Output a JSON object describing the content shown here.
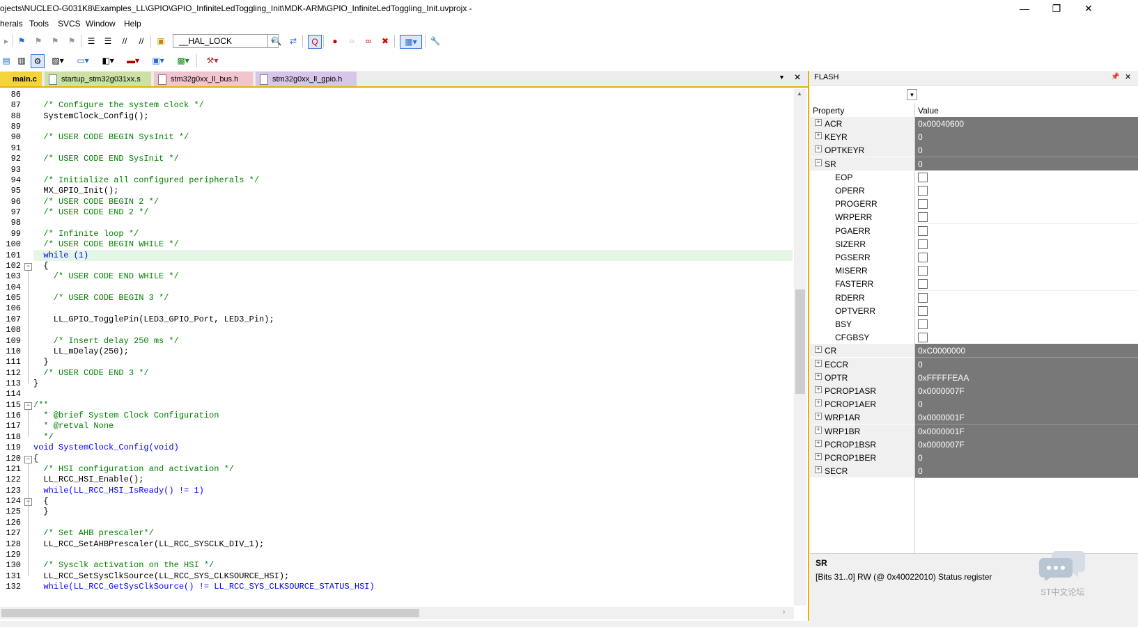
{
  "window": {
    "title": "ojects\\NUCLEO-G031K8\\Examples_LL\\GPIO\\GPIO_InfiniteLedToggling_Init\\MDK-ARM\\GPIO_InfiniteLedToggling_Init.uvprojx -",
    "minimize": "—",
    "maximize": "❐",
    "close": "✕"
  },
  "menu": [
    "herals",
    "Tools",
    "SVCS",
    "Window",
    "Help"
  ],
  "toolbar": {
    "combo_value": "__HAL_LOCK"
  },
  "tabs": [
    {
      "label": "main.c",
      "color": "#f5d33a"
    },
    {
      "label": "startup_stm32g031xx.s",
      "color": "#cde0a6"
    },
    {
      "label": "stm32g0xx_ll_bus.h",
      "color": "#f2c4cf"
    },
    {
      "label": "stm32g0xx_ll_gpio.h",
      "color": "#d7c5ea"
    }
  ],
  "code": [
    {
      "n": "86",
      "t": ""
    },
    {
      "n": "87",
      "t": "  /* Configure the system clock */"
    },
    {
      "n": "88",
      "t": "  SystemClock_Config();"
    },
    {
      "n": "89",
      "t": ""
    },
    {
      "n": "90",
      "t": "  /* USER CODE BEGIN SysInit */"
    },
    {
      "n": "91",
      "t": ""
    },
    {
      "n": "92",
      "t": "  /* USER CODE END SysInit */"
    },
    {
      "n": "93",
      "t": ""
    },
    {
      "n": "94",
      "t": "  /* Initialize all configured peripherals */"
    },
    {
      "n": "95",
      "t": "  MX_GPIO_Init();"
    },
    {
      "n": "96",
      "t": "  /* USER CODE BEGIN 2 */"
    },
    {
      "n": "97",
      "t": "  /* USER CODE END 2 */"
    },
    {
      "n": "98",
      "t": ""
    },
    {
      "n": "99",
      "t": "  /* Infinite loop */"
    },
    {
      "n": "100",
      "t": "  /* USER CODE BEGIN WHILE */"
    },
    {
      "n": "101",
      "t": "  while (1)"
    },
    {
      "n": "102",
      "t": "  {"
    },
    {
      "n": "103",
      "t": "    /* USER CODE END WHILE */"
    },
    {
      "n": "104",
      "t": ""
    },
    {
      "n": "105",
      "t": "    /* USER CODE BEGIN 3 */"
    },
    {
      "n": "106",
      "t": ""
    },
    {
      "n": "107",
      "t": "    LL_GPIO_TogglePin(LED3_GPIO_Port, LED3_Pin);"
    },
    {
      "n": "108",
      "t": ""
    },
    {
      "n": "109",
      "t": "    /* Insert delay 250 ms */"
    },
    {
      "n": "110",
      "t": "    LL_mDelay(250);"
    },
    {
      "n": "111",
      "t": "  }"
    },
    {
      "n": "112",
      "t": "  /* USER CODE END 3 */"
    },
    {
      "n": "113",
      "t": "}"
    },
    {
      "n": "114",
      "t": ""
    },
    {
      "n": "115",
      "t": "/**"
    },
    {
      "n": "116",
      "t": "  * @brief System Clock Configuration"
    },
    {
      "n": "117",
      "t": "  * @retval None"
    },
    {
      "n": "118",
      "t": "  */"
    },
    {
      "n": "119",
      "t": "void SystemClock_Config(void)"
    },
    {
      "n": "120",
      "t": "{"
    },
    {
      "n": "121",
      "t": "  /* HSI configuration and activation */"
    },
    {
      "n": "122",
      "t": "  LL_RCC_HSI_Enable();"
    },
    {
      "n": "123",
      "t": "  while(LL_RCC_HSI_IsReady() != 1)"
    },
    {
      "n": "124",
      "t": "  {"
    },
    {
      "n": "125",
      "t": "  }"
    },
    {
      "n": "126",
      "t": ""
    },
    {
      "n": "127",
      "t": "  /* Set AHB prescaler*/"
    },
    {
      "n": "128",
      "t": "  LL_RCC_SetAHBPrescaler(LL_RCC_SYSCLK_DIV_1);"
    },
    {
      "n": "129",
      "t": ""
    },
    {
      "n": "130",
      "t": "  /* Sysclk activation on the HSI */"
    },
    {
      "n": "131",
      "t": "  LL_RCC_SetSysClkSource(LL_RCC_SYS_CLKSOURCE_HSI);"
    },
    {
      "n": "132",
      "t": "  while(LL_RCC_GetSysClkSource() != LL_RCC_SYS_CLKSOURCE_STATUS_HSI)"
    }
  ],
  "panel": {
    "title": "FLASH",
    "col_property": "Property",
    "col_value": "Value",
    "rows": [
      {
        "name": "ACR",
        "value": "0x00040600",
        "kind": "reg"
      },
      {
        "name": "KEYR",
        "value": "0",
        "kind": "reg"
      },
      {
        "name": "OPTKEYR",
        "value": "0",
        "kind": "reg"
      },
      {
        "name": "SR",
        "value": "0",
        "kind": "open"
      },
      {
        "name": "EOP",
        "kind": "bit"
      },
      {
        "name": "OPERR",
        "kind": "bit"
      },
      {
        "name": "PROGERR",
        "kind": "bit"
      },
      {
        "name": "WRPERR",
        "kind": "bit"
      },
      {
        "name": "PGAERR",
        "kind": "bit"
      },
      {
        "name": "SIZERR",
        "kind": "bit"
      },
      {
        "name": "PGSERR",
        "kind": "bit"
      },
      {
        "name": "MISERR",
        "kind": "bit"
      },
      {
        "name": "FASTERR",
        "kind": "bit"
      },
      {
        "name": "RDERR",
        "kind": "bit"
      },
      {
        "name": "OPTVERR",
        "kind": "bit"
      },
      {
        "name": "BSY",
        "kind": "bit"
      },
      {
        "name": "CFGBSY",
        "kind": "bit"
      },
      {
        "name": "CR",
        "value": "0xC0000000",
        "kind": "reg"
      },
      {
        "name": "ECCR",
        "value": "0",
        "kind": "reg"
      },
      {
        "name": "OPTR",
        "value": "0xFFFFFEAA",
        "kind": "reg"
      },
      {
        "name": "PCROP1ASR",
        "value": "0x0000007F",
        "kind": "reg"
      },
      {
        "name": "PCROP1AER",
        "value": "0",
        "kind": "reg"
      },
      {
        "name": "WRP1AR",
        "value": "0x0000001F",
        "kind": "reg"
      },
      {
        "name": "WRP1BR",
        "value": "0x0000001F",
        "kind": "reg"
      },
      {
        "name": "PCROP1BSR",
        "value": "0x0000007F",
        "kind": "reg"
      },
      {
        "name": "PCROP1BER",
        "value": "0",
        "kind": "reg"
      },
      {
        "name": "SECR",
        "value": "0",
        "kind": "reg"
      }
    ],
    "info_name": "SR",
    "info_desc": "[Bits 31..0] RW (@ 0x40022010) Status register"
  },
  "watermark": "ST中文论坛",
  "colors": {
    "comment": "#008000",
    "keyword": "#0000ff",
    "highlight": "#e4f6e6",
    "accent": "#e8b100"
  }
}
